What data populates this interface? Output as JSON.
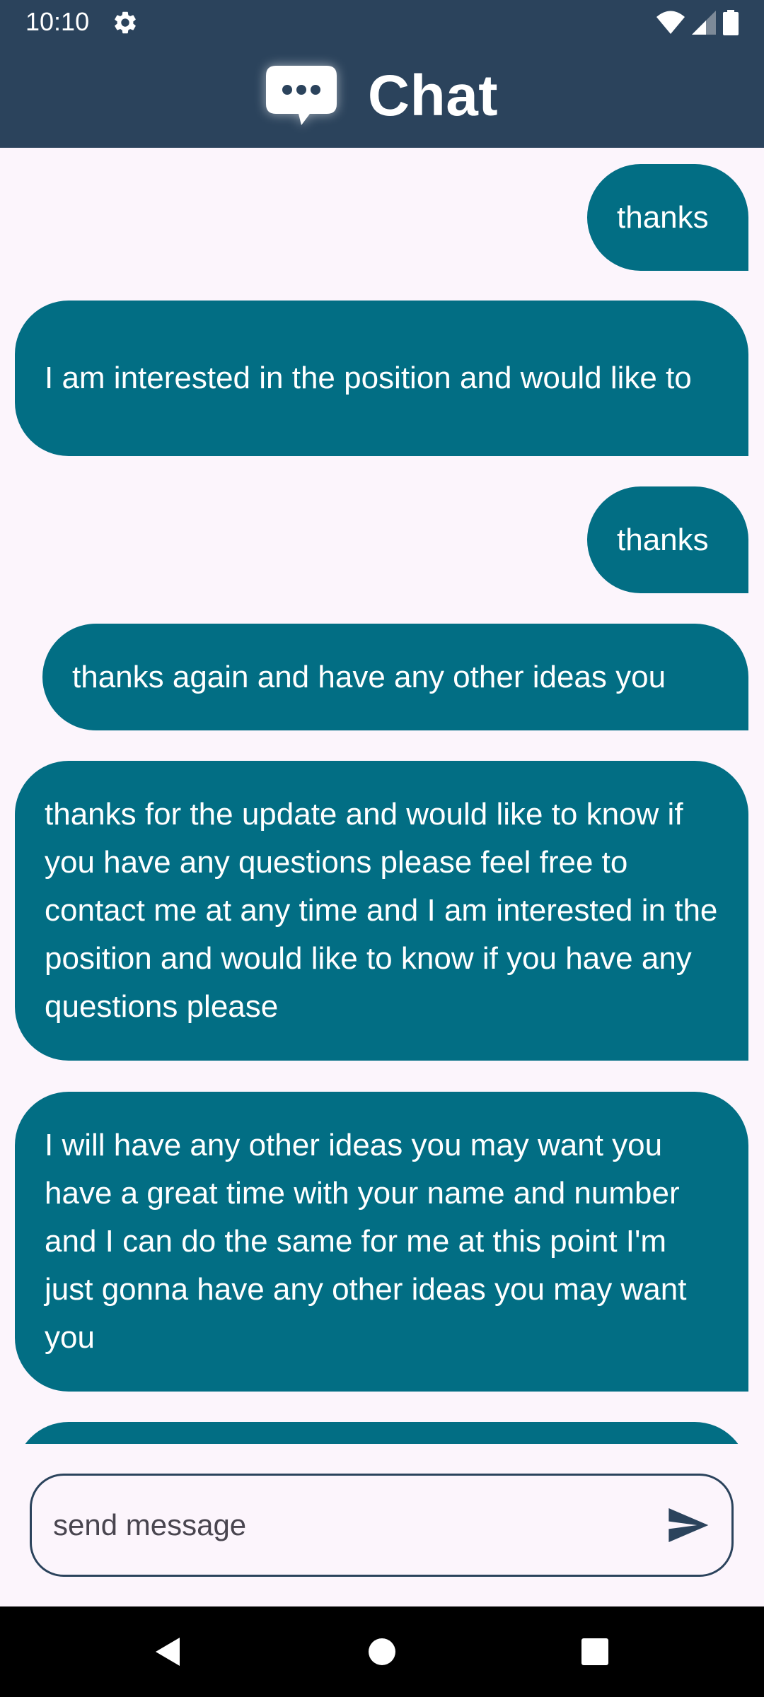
{
  "status_bar": {
    "time": "10:10",
    "icons": [
      "settings-gear-icon",
      "wifi-icon",
      "cell-signal-icon",
      "battery-icon"
    ]
  },
  "app_bar": {
    "title": "Chat",
    "logo_icon": "chat-bubble-icon"
  },
  "colors": {
    "header_bg": "#2b435c",
    "bubble_bg": "#026e84",
    "page_bg": "#fcf5fc",
    "bubble_text": "#ffffff"
  },
  "messages": [
    {
      "text": "thanks"
    },
    {
      "text": "I am interested in the position and would like to"
    },
    {
      "text": "thanks"
    },
    {
      "text": "thanks again and have any other ideas you"
    },
    {
      "text": "thanks for the update and would like to know if you have any questions please feel free to contact me at any time and I am interested in the position and would like to know if you have any questions please"
    },
    {
      "text": "I will have any other ideas you may want you have a great time with your name and number and I can do the same for me at this point I'm just gonna have any other ideas you may want you"
    }
  ],
  "composer": {
    "placeholder": "send message",
    "value": "",
    "send_icon": "send-icon"
  },
  "nav_bar": {
    "icons": [
      "back-icon",
      "home-icon",
      "recents-icon"
    ]
  }
}
